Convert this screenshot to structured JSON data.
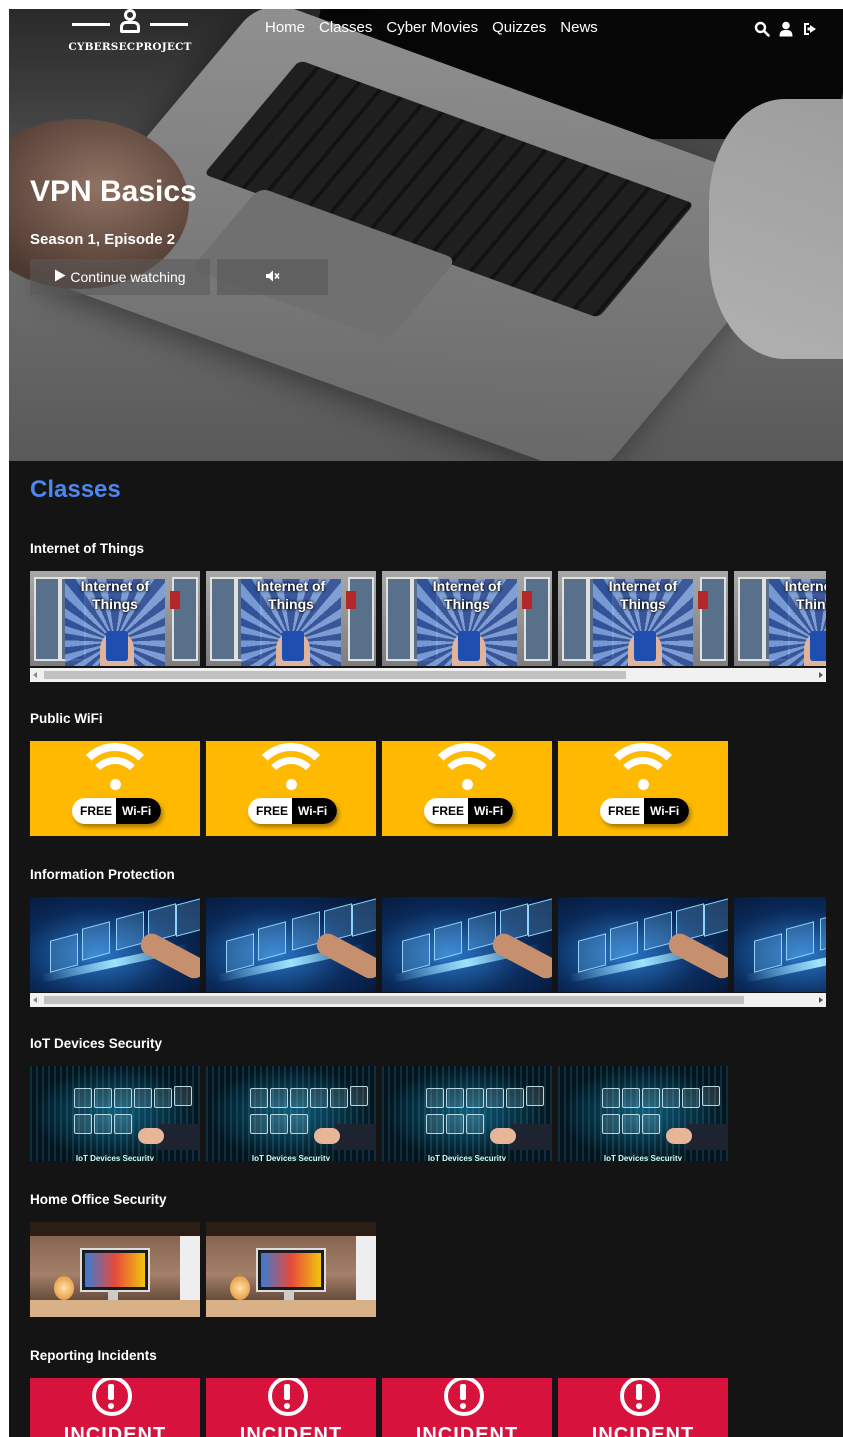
{
  "site": {
    "logo_text": "CYBERSECPROJECT"
  },
  "nav": {
    "items": [
      "Home",
      "Classes",
      "Cyber Movies",
      "Quizzes",
      "News"
    ]
  },
  "nav_icons": [
    "search-icon",
    "user-icon",
    "sign-out-icon"
  ],
  "hero": {
    "title": "VPN Basics",
    "subtitle": "Season 1, Episode 2",
    "continue_label": "Continue watching",
    "mute_icon": "volume-mute-icon"
  },
  "classes": {
    "heading": "Classes",
    "rows": [
      {
        "title": "Internet of Things",
        "tile_text": "Internet of Things",
        "tile_count": 5,
        "scrollbar": true
      },
      {
        "title": "Public WiFi",
        "tile_badge_free": "FREE",
        "tile_badge_wifi": "Wi-Fi",
        "tile_count": 4,
        "scrollbar": false
      },
      {
        "title": "Information Protection",
        "tile_count": 5,
        "scrollbar": true
      },
      {
        "title": "IoT Devices Security",
        "tile_caption": "IoT Devices Security",
        "tile_count": 4,
        "scrollbar": false
      },
      {
        "title": "Home Office Security",
        "tile_count": 2,
        "scrollbar": false
      },
      {
        "title": "Reporting Incidents",
        "tile_text": "INCIDENT",
        "tile_count": 4,
        "scrollbar": false
      }
    ]
  },
  "colors": {
    "accent": "#4a87f0",
    "background": "#141414",
    "wifi_yellow": "#ffb900",
    "incident_red": "#d6123d"
  }
}
